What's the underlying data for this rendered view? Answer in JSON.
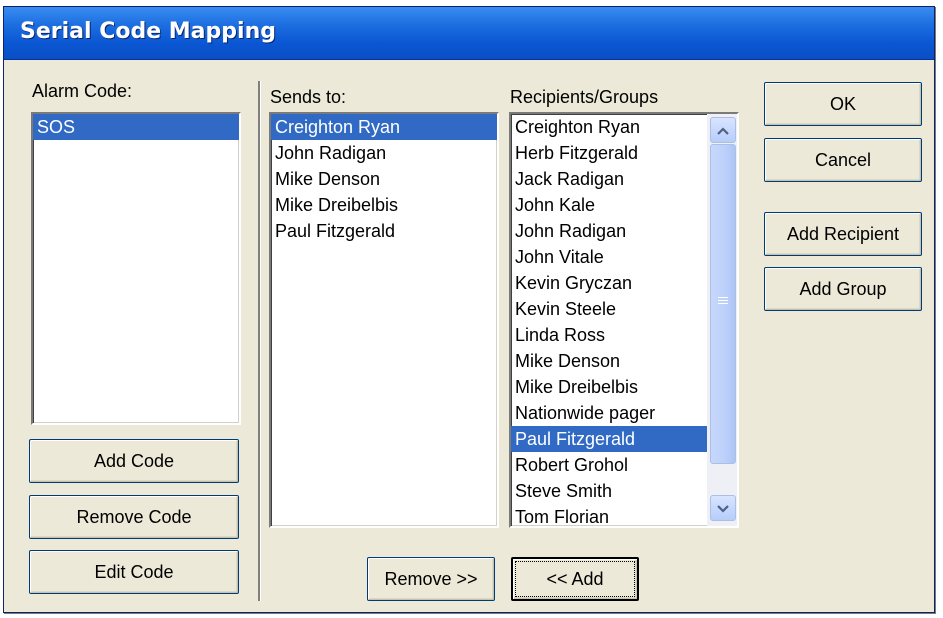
{
  "window": {
    "title": "Serial Code Mapping"
  },
  "alarm_code": {
    "label": "Alarm Code:",
    "items": [
      "SOS"
    ],
    "selected_index": 0
  },
  "sends_to": {
    "label": "Sends to:",
    "items": [
      "Creighton Ryan",
      "John Radigan",
      "Mike Denson",
      "Mike Dreibelbis",
      "Paul Fitzgerald"
    ],
    "selected_index": 0
  },
  "recipients": {
    "label": "Recipients/Groups",
    "items": [
      "Creighton Ryan",
      "Herb Fitzgerald",
      "Jack Radigan",
      "John Kale",
      "John Radigan",
      "John Vitale",
      "Kevin Gryczan",
      "Kevin Steele",
      "Linda Ross",
      "Mike Denson",
      "Mike Dreibelbis",
      "Nationwide pager",
      "Paul Fitzgerald",
      "Robert Grohol",
      "Steve Smith",
      "Tom Florian"
    ],
    "selected_index": 12
  },
  "buttons": {
    "add_code": "Add Code",
    "remove_code": "Remove Code",
    "edit_code": "Edit Code",
    "remove": "Remove >>",
    "add": "<< Add",
    "ok": "OK",
    "cancel": "Cancel",
    "add_recipient": "Add Recipient",
    "add_group": "Add Group"
  },
  "icons": {
    "scroll_up": "chevron-up-icon",
    "scroll_down": "chevron-down-icon",
    "scroll_grip": "grip-icon"
  },
  "colors": {
    "title_bar": "#0a56d3",
    "selection": "#316ac5",
    "dialog_bg": "#ece9d8"
  }
}
